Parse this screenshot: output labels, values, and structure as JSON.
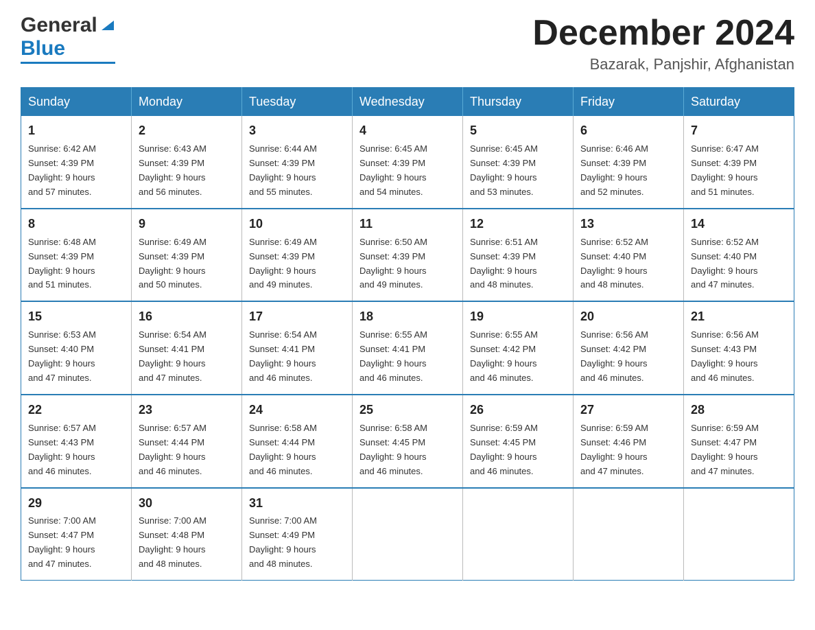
{
  "header": {
    "logo_general": "General",
    "logo_blue": "Blue",
    "month_title": "December 2024",
    "location": "Bazarak, Panjshir, Afghanistan"
  },
  "weekdays": [
    "Sunday",
    "Monday",
    "Tuesday",
    "Wednesday",
    "Thursday",
    "Friday",
    "Saturday"
  ],
  "weeks": [
    [
      {
        "day": "1",
        "sunrise": "6:42 AM",
        "sunset": "4:39 PM",
        "daylight": "9 hours and 57 minutes."
      },
      {
        "day": "2",
        "sunrise": "6:43 AM",
        "sunset": "4:39 PM",
        "daylight": "9 hours and 56 minutes."
      },
      {
        "day": "3",
        "sunrise": "6:44 AM",
        "sunset": "4:39 PM",
        "daylight": "9 hours and 55 minutes."
      },
      {
        "day": "4",
        "sunrise": "6:45 AM",
        "sunset": "4:39 PM",
        "daylight": "9 hours and 54 minutes."
      },
      {
        "day": "5",
        "sunrise": "6:45 AM",
        "sunset": "4:39 PM",
        "daylight": "9 hours and 53 minutes."
      },
      {
        "day": "6",
        "sunrise": "6:46 AM",
        "sunset": "4:39 PM",
        "daylight": "9 hours and 52 minutes."
      },
      {
        "day": "7",
        "sunrise": "6:47 AM",
        "sunset": "4:39 PM",
        "daylight": "9 hours and 51 minutes."
      }
    ],
    [
      {
        "day": "8",
        "sunrise": "6:48 AM",
        "sunset": "4:39 PM",
        "daylight": "9 hours and 51 minutes."
      },
      {
        "day": "9",
        "sunrise": "6:49 AM",
        "sunset": "4:39 PM",
        "daylight": "9 hours and 50 minutes."
      },
      {
        "day": "10",
        "sunrise": "6:49 AM",
        "sunset": "4:39 PM",
        "daylight": "9 hours and 49 minutes."
      },
      {
        "day": "11",
        "sunrise": "6:50 AM",
        "sunset": "4:39 PM",
        "daylight": "9 hours and 49 minutes."
      },
      {
        "day": "12",
        "sunrise": "6:51 AM",
        "sunset": "4:39 PM",
        "daylight": "9 hours and 48 minutes."
      },
      {
        "day": "13",
        "sunrise": "6:52 AM",
        "sunset": "4:40 PM",
        "daylight": "9 hours and 48 minutes."
      },
      {
        "day": "14",
        "sunrise": "6:52 AM",
        "sunset": "4:40 PM",
        "daylight": "9 hours and 47 minutes."
      }
    ],
    [
      {
        "day": "15",
        "sunrise": "6:53 AM",
        "sunset": "4:40 PM",
        "daylight": "9 hours and 47 minutes."
      },
      {
        "day": "16",
        "sunrise": "6:54 AM",
        "sunset": "4:41 PM",
        "daylight": "9 hours and 47 minutes."
      },
      {
        "day": "17",
        "sunrise": "6:54 AM",
        "sunset": "4:41 PM",
        "daylight": "9 hours and 46 minutes."
      },
      {
        "day": "18",
        "sunrise": "6:55 AM",
        "sunset": "4:41 PM",
        "daylight": "9 hours and 46 minutes."
      },
      {
        "day": "19",
        "sunrise": "6:55 AM",
        "sunset": "4:42 PM",
        "daylight": "9 hours and 46 minutes."
      },
      {
        "day": "20",
        "sunrise": "6:56 AM",
        "sunset": "4:42 PM",
        "daylight": "9 hours and 46 minutes."
      },
      {
        "day": "21",
        "sunrise": "6:56 AM",
        "sunset": "4:43 PM",
        "daylight": "9 hours and 46 minutes."
      }
    ],
    [
      {
        "day": "22",
        "sunrise": "6:57 AM",
        "sunset": "4:43 PM",
        "daylight": "9 hours and 46 minutes."
      },
      {
        "day": "23",
        "sunrise": "6:57 AM",
        "sunset": "4:44 PM",
        "daylight": "9 hours and 46 minutes."
      },
      {
        "day": "24",
        "sunrise": "6:58 AM",
        "sunset": "4:44 PM",
        "daylight": "9 hours and 46 minutes."
      },
      {
        "day": "25",
        "sunrise": "6:58 AM",
        "sunset": "4:45 PM",
        "daylight": "9 hours and 46 minutes."
      },
      {
        "day": "26",
        "sunrise": "6:59 AM",
        "sunset": "4:45 PM",
        "daylight": "9 hours and 46 minutes."
      },
      {
        "day": "27",
        "sunrise": "6:59 AM",
        "sunset": "4:46 PM",
        "daylight": "9 hours and 47 minutes."
      },
      {
        "day": "28",
        "sunrise": "6:59 AM",
        "sunset": "4:47 PM",
        "daylight": "9 hours and 47 minutes."
      }
    ],
    [
      {
        "day": "29",
        "sunrise": "7:00 AM",
        "sunset": "4:47 PM",
        "daylight": "9 hours and 47 minutes."
      },
      {
        "day": "30",
        "sunrise": "7:00 AM",
        "sunset": "4:48 PM",
        "daylight": "9 hours and 48 minutes."
      },
      {
        "day": "31",
        "sunrise": "7:00 AM",
        "sunset": "4:49 PM",
        "daylight": "9 hours and 48 minutes."
      },
      null,
      null,
      null,
      null
    ]
  ],
  "labels": {
    "sunrise": "Sunrise:",
    "sunset": "Sunset:",
    "daylight": "Daylight:"
  }
}
